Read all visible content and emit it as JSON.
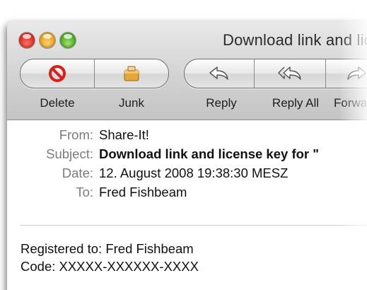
{
  "window": {
    "title": "Download link and license key for"
  },
  "toolbar": {
    "buttons": [
      {
        "label": "Delete",
        "icon": "delete-icon"
      },
      {
        "label": "Junk",
        "icon": "junk-icon"
      },
      {
        "label": "Reply",
        "icon": "reply-icon"
      },
      {
        "label": "Reply All",
        "icon": "reply-all-icon"
      },
      {
        "label": "Forward",
        "icon": "forward-icon"
      }
    ]
  },
  "headers": {
    "from_key": "From:",
    "from_val": "Share-It!",
    "subject_key": "Subject:",
    "subject_val": "Download link and license key for \"",
    "date_key": "Date:",
    "date_val": "12. August 2008 19:38:30 MESZ",
    "to_key": "To:",
    "to_val": "Fred Fishbeam"
  },
  "body": {
    "line1": "Registered to: Fred Fishbeam",
    "line2": "Code: XXXXX-XXXXXX-XXXX"
  },
  "colors": {
    "close": "#d8231c",
    "minimize": "#e39b12",
    "zoom": "#3fa41d",
    "header_key": "#7b7b7b"
  }
}
